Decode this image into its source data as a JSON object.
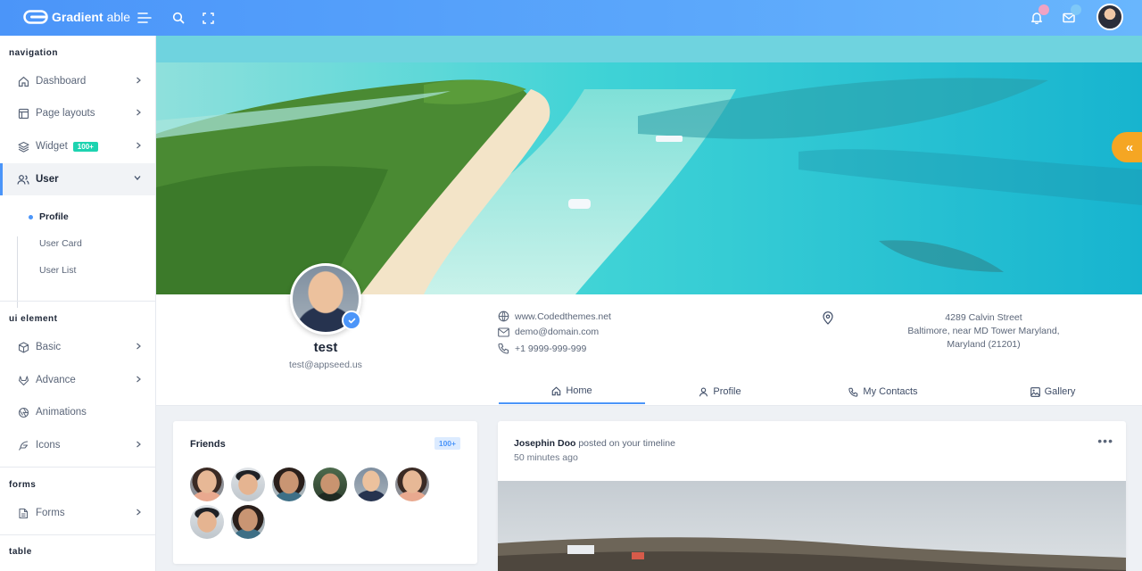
{
  "app": {
    "brand_bold": "Gradient",
    "brand_thin": "able"
  },
  "topbar": {
    "icons": [
      "menu-icon",
      "search-icon",
      "fullscreen-icon",
      "bell-icon",
      "mail-icon"
    ],
    "colors": {
      "bar": "#4b95f9",
      "bell_dot": "#f0a3c4",
      "mail_dot": "#7ec8f8"
    }
  },
  "sidebar": {
    "captions": {
      "navigation": "navigation",
      "ui_element": "ui element",
      "forms": "forms",
      "table": "table"
    },
    "items": [
      {
        "label": "Dashboard",
        "icon": "home-icon"
      },
      {
        "label": "Page layouts",
        "icon": "layout-icon"
      },
      {
        "label": "Widget",
        "icon": "layers-icon",
        "badge": "100+"
      },
      {
        "label": "User",
        "icon": "users-icon",
        "active": true
      },
      {
        "label": "Basic",
        "icon": "box-icon"
      },
      {
        "label": "Advance",
        "icon": "gitlab-icon"
      },
      {
        "label": "Animations",
        "icon": "aperture-icon"
      },
      {
        "label": "Icons",
        "icon": "feather-icon"
      },
      {
        "label": "Forms",
        "icon": "file-text-icon"
      }
    ],
    "user_sub": [
      "Profile",
      "User Card",
      "User List"
    ]
  },
  "profile": {
    "name": "test",
    "email": "test@appseed.us",
    "website": "www.Codedthemes.net",
    "contact_email": "demo@domain.com",
    "phone": "+1 9999-999-999",
    "address_lines": [
      "4289 Calvin Street",
      "Baltimore, near MD Tower Maryland,",
      "Maryland (21201)"
    ],
    "tabs": [
      "Home",
      "Profile",
      "My Contacts",
      "Gallery"
    ],
    "active_tab": "Home"
  },
  "friends": {
    "title": "Friends",
    "badge": "100+",
    "count_shown": 8
  },
  "post": {
    "author": "Josephin Doo",
    "action": "posted on your timeline",
    "time": "50 minutes ago",
    "more": "•••"
  },
  "side_toggle": "«"
}
